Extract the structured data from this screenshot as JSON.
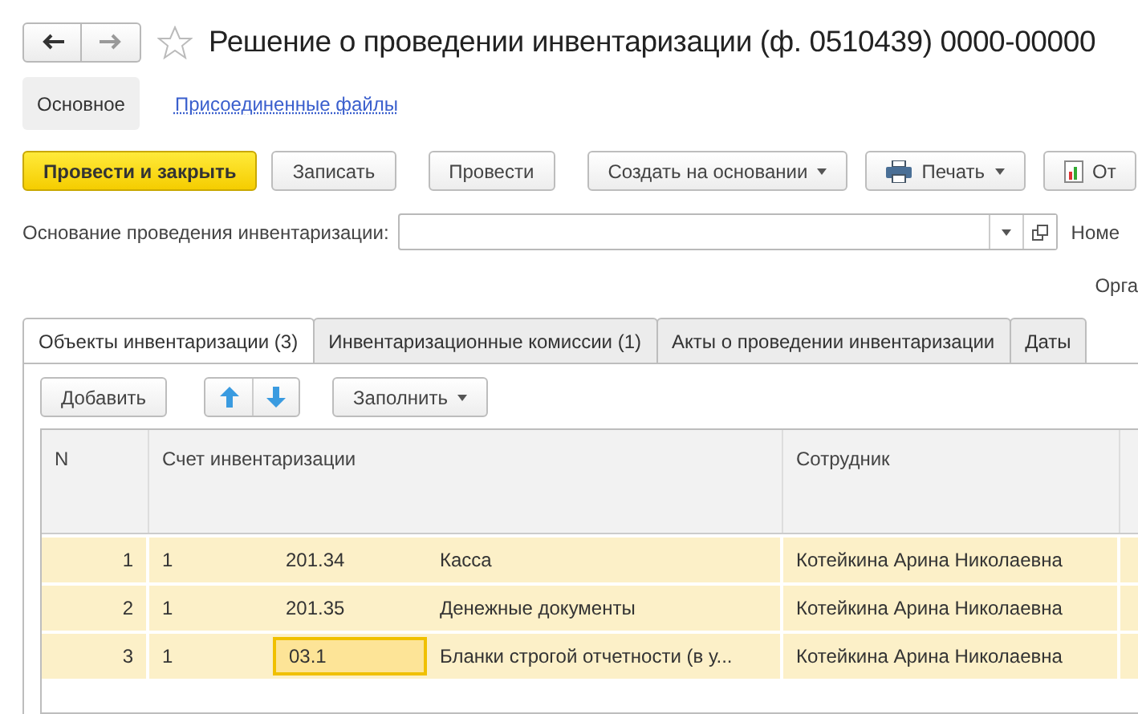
{
  "window": {
    "title": "Решение о проведении инвентаризации (ф. 0510439) 0000-00000"
  },
  "sections": [
    {
      "label": "Основное",
      "selected": true
    },
    {
      "label": "Присоединенные файлы",
      "selected": false
    }
  ],
  "toolbar": [
    {
      "label": "Провести и закрыть",
      "kind": "primary"
    },
    {
      "label": "Записать",
      "kind": "plain"
    },
    {
      "label": "Провести",
      "kind": "plain"
    },
    {
      "label": "Создать на основании",
      "kind": "menu"
    },
    {
      "label": "Печать",
      "kind": "print"
    },
    {
      "label": "От",
      "kind": "report"
    }
  ],
  "basis_field": {
    "label": "Основание проведения инвентаризации:"
  },
  "side_labels": [
    "Номе",
    "Орга"
  ],
  "tabs": [
    {
      "label": "Объекты инвентаризации (3)",
      "selected": true
    },
    {
      "label": "Инвентаризационные комиссии (1)",
      "selected": false
    },
    {
      "label": "Акты о проведении инвентаризации",
      "selected": false
    },
    {
      "label": "Даты",
      "selected": false
    }
  ],
  "table_toolbar": {
    "add": "Добавить",
    "fill": "Заполнить"
  },
  "table": {
    "columns": [
      "N",
      "Счет инвентаризации",
      "Сотрудник"
    ],
    "rows": [
      {
        "n": "1",
        "kind_code": "1",
        "account": "201.34",
        "name": "Касса",
        "employee": "Котейкина Арина Николаевна",
        "active": false
      },
      {
        "n": "2",
        "kind_code": "1",
        "account": "201.35",
        "name": "Денежные документы",
        "employee": "Котейкина Арина Николаевна",
        "active": false
      },
      {
        "n": "3",
        "kind_code": "1",
        "account": "03.1",
        "name": "Бланки строгой отчетности (в у...",
        "employee": "Котейкина Арина Николаевна",
        "active": true
      }
    ]
  }
}
